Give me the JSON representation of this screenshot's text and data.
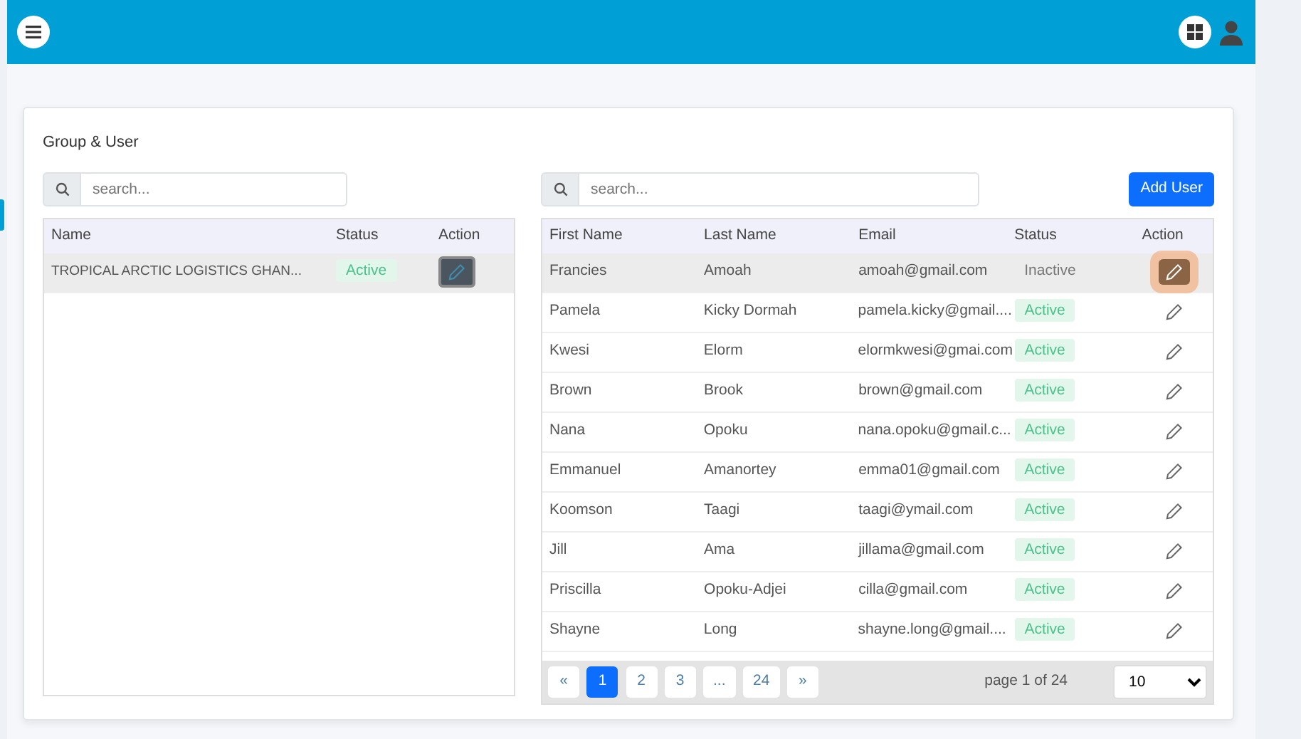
{
  "page_title": "Group & User",
  "groups": {
    "search": {
      "placeholder": "search..."
    },
    "columns": [
      "Name",
      "Status",
      "Action"
    ],
    "rows": [
      {
        "name": "TROPICAL ARCTIC LOGISTICS GHAN...",
        "status": "Active",
        "active": true,
        "selected": true
      }
    ]
  },
  "users": {
    "search": {
      "placeholder": "search..."
    },
    "add_button": "Add User",
    "columns": [
      "First Name",
      "Last Name",
      "Email",
      "Status",
      "Action"
    ],
    "rows": [
      {
        "first_name": "Francies",
        "last_name": "Amoah",
        "email": "amoah@gmail.com",
        "status": "Inactive",
        "active": false,
        "selected": true
      },
      {
        "first_name": "Pamela",
        "last_name": "Kicky Dormah",
        "email": "pamela.kicky@gmail....",
        "status": "Active",
        "active": true,
        "selected": false
      },
      {
        "first_name": "Kwesi",
        "last_name": "Elorm",
        "email": "elormkwesi@gmai.com",
        "status": "Active",
        "active": true,
        "selected": false
      },
      {
        "first_name": "Brown",
        "last_name": "Brook",
        "email": "brown@gmail.com",
        "status": "Active",
        "active": true,
        "selected": false
      },
      {
        "first_name": "Nana",
        "last_name": "Opoku",
        "email": "nana.opoku@gmail.c...",
        "status": "Active",
        "active": true,
        "selected": false
      },
      {
        "first_name": "Emmanuel",
        "last_name": "Amanortey",
        "email": "emma01@gmail.com",
        "status": "Active",
        "active": true,
        "selected": false
      },
      {
        "first_name": "Koomson",
        "last_name": "Taagi",
        "email": "taagi@ymail.com",
        "status": "Active",
        "active": true,
        "selected": false
      },
      {
        "first_name": "Jill",
        "last_name": "Ama",
        "email": "jillama@gmail.com",
        "status": "Active",
        "active": true,
        "selected": false
      },
      {
        "first_name": "Priscilla",
        "last_name": "Opoku-Adjei",
        "email": "cilla@gmail.com",
        "status": "Active",
        "active": true,
        "selected": false
      },
      {
        "first_name": "Shayne",
        "last_name": "Long",
        "email": "shayne.long@gmail....",
        "status": "Active",
        "active": true,
        "selected": false
      }
    ],
    "pagination": {
      "pages": [
        {
          "label": "«",
          "selected": false
        },
        {
          "label": "1",
          "selected": true
        },
        {
          "label": "2",
          "selected": false
        },
        {
          "label": "3",
          "selected": false
        },
        {
          "label": "...",
          "selected": false
        },
        {
          "label": "24",
          "selected": false
        },
        {
          "label": "»",
          "selected": false
        }
      ],
      "page_info": "page 1 of 24",
      "page_size": "10"
    }
  }
}
